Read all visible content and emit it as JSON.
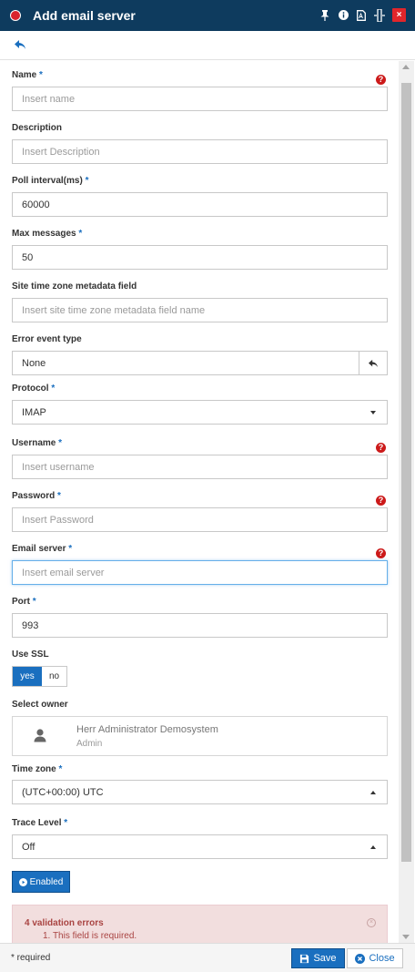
{
  "window": {
    "title": "Add email server",
    "title_icons": [
      "pin-icon",
      "info-icon",
      "pdf-icon",
      "resize-icon",
      "close-icon"
    ],
    "close_glyph": "×"
  },
  "toolbar": {
    "back_icon": "back-arrow-icon"
  },
  "form": {
    "required_mark": "*",
    "help_glyph": "?",
    "name": {
      "label": "Name",
      "placeholder": "Insert name"
    },
    "description": {
      "label": "Description",
      "placeholder": "Insert Description"
    },
    "poll_interval": {
      "label": "Poll interval(ms)",
      "value": "60000"
    },
    "max_messages": {
      "label": "Max messages",
      "value": "50"
    },
    "site_tz_field": {
      "label": "Site time zone metadata field",
      "placeholder": "Insert site time zone metadata field name"
    },
    "error_event_type": {
      "label": "Error event type",
      "value": "None"
    },
    "protocol": {
      "label": "Protocol",
      "value": "IMAP"
    },
    "username": {
      "label": "Username",
      "placeholder": "Insert username"
    },
    "password": {
      "label": "Password",
      "placeholder": "Insert Password"
    },
    "email_server": {
      "label": "Email server",
      "placeholder": "Insert email server"
    },
    "port": {
      "label": "Port",
      "value": "993"
    },
    "use_ssl": {
      "label": "Use SSL",
      "yes": "yes",
      "no": "no",
      "selected": "yes"
    },
    "owner": {
      "label": "Select owner",
      "name": "Herr Administrator Demosystem",
      "role": "Admin"
    },
    "time_zone": {
      "label": "Time zone",
      "value": "(UTC+00:00) UTC"
    },
    "trace_level": {
      "label": "Trace Level",
      "value": "Off"
    },
    "enabled_button": "Enabled"
  },
  "validation": {
    "title": "4 validation errors",
    "items": [
      "1. This field is required."
    ],
    "close_glyph": "×"
  },
  "footer": {
    "required_note": "* required",
    "save_label": "Save",
    "close_label": "Close"
  },
  "colors": {
    "titlebar": "#0e3b5e",
    "accent": "#1a6fbf",
    "error": "#a94442",
    "help": "#cc1a1a"
  }
}
